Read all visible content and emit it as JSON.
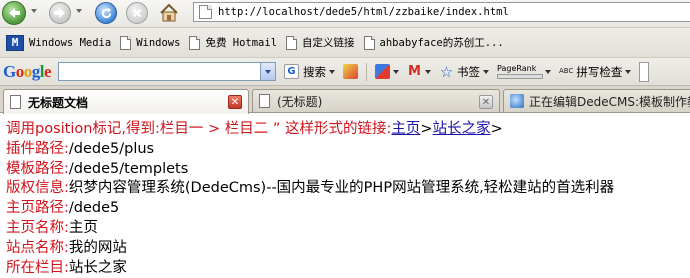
{
  "browser": {
    "url": "http://localhost/dede5/html/zzbaike/index.html",
    "bookmarks": [
      {
        "label": "Windows Media",
        "icon": "windows-media-icon"
      },
      {
        "label": "Windows",
        "icon": "page-icon"
      },
      {
        "label": "免费 Hotmail",
        "icon": "page-icon"
      },
      {
        "label": "自定义链接",
        "icon": "page-icon"
      },
      {
        "label": "ahbabyface的苏创工...",
        "icon": "page-icon"
      }
    ],
    "google_toolbar": {
      "logo": "Google",
      "search_value": "",
      "search_button": "搜索",
      "bookmarks_label": "书签",
      "pagerank_label": "PageRank",
      "spellcheck_label": "拼写检查",
      "abc_label": "ABC"
    },
    "tabs": [
      {
        "title": "无标题文档",
        "active": true
      },
      {
        "title": "(无标题)",
        "active": false
      },
      {
        "title": "正在编辑DedeCMS:模板制作教程",
        "active": false
      }
    ]
  },
  "page": {
    "intro_label": "调用position标记,得到:栏目一 > 栏目二 ” 这样形式的链接:",
    "breadcrumb_home": "主页",
    "breadcrumb_sep": ">",
    "breadcrumb_current": "站长之家",
    "breadcrumb_trailing": ">",
    "rows": [
      {
        "label": "插件路径:",
        "value": "/dede5/plus"
      },
      {
        "label": "模板路径:",
        "value": "/dede5/templets"
      },
      {
        "label": "版权信息:",
        "value": "织梦内容管理系统(DedeCms)--国内最专业的PHP网站管理系统,轻松建站的首选利器"
      },
      {
        "label": "主页路径:",
        "value": "/dede5"
      },
      {
        "label": "主页名称:",
        "value": "主页"
      },
      {
        "label": "站点名称:",
        "value": "我的网站"
      },
      {
        "label": "所在栏目:",
        "value": "站长之家"
      }
    ]
  },
  "colors": {
    "label": "#d0141c",
    "link": "#1a14a8",
    "text": "#000000"
  }
}
